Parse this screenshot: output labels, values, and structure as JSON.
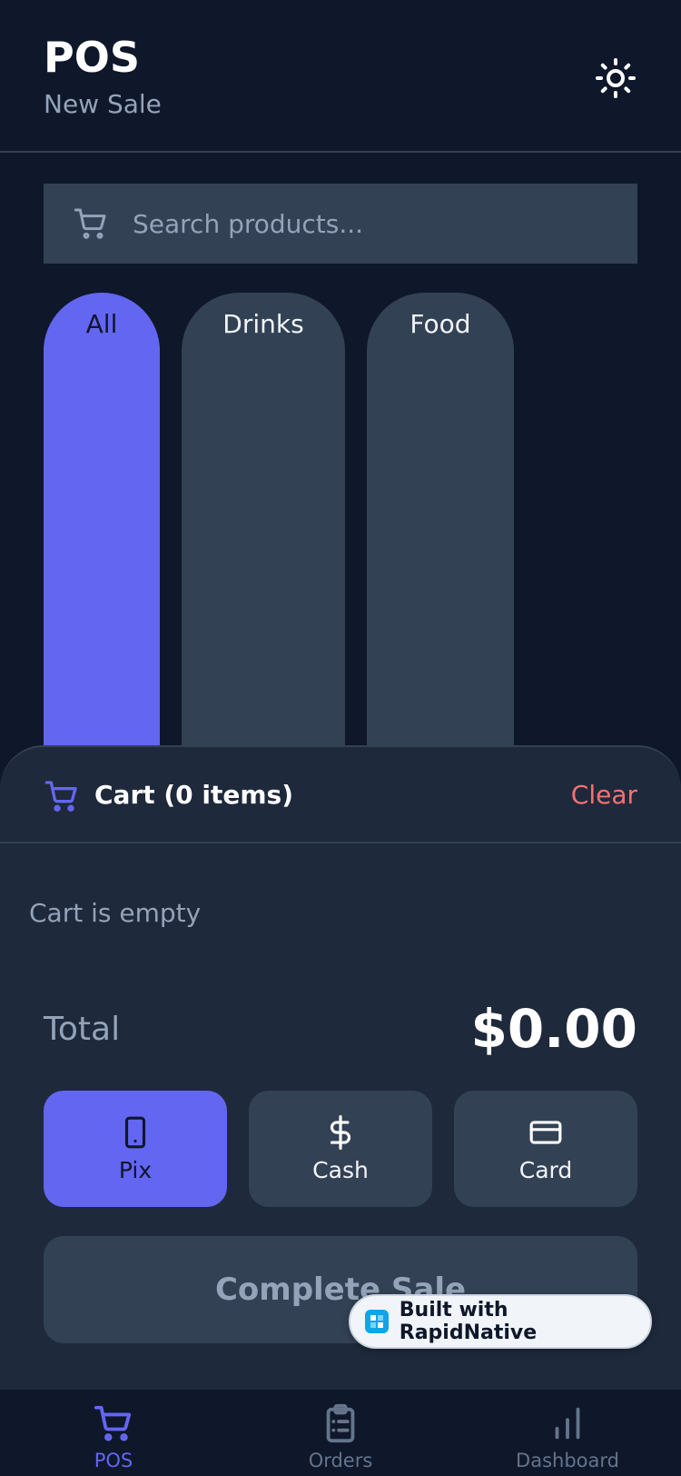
{
  "header": {
    "title": "POS",
    "subtitle": "New Sale",
    "theme_icon": "sun-icon"
  },
  "search": {
    "placeholder": "Search products...",
    "value": ""
  },
  "categories": [
    {
      "label": "All",
      "active": true
    },
    {
      "label": "Drinks",
      "active": false
    },
    {
      "label": "Food",
      "active": false
    }
  ],
  "cart": {
    "title": "Cart (0 items)",
    "clear_label": "Clear",
    "empty_text": "Cart is empty",
    "total_label": "Total",
    "total_value": "$0.00"
  },
  "payment_methods": [
    {
      "label": "Pix",
      "icon": "smartphone-icon",
      "active": true
    },
    {
      "label": "Cash",
      "icon": "dollar-icon",
      "active": false
    },
    {
      "label": "Card",
      "icon": "credit-card-icon",
      "active": false
    }
  ],
  "complete_sale_label": "Complete Sale",
  "badge": {
    "text": "Built with RapidNative"
  },
  "tabs": [
    {
      "label": "POS",
      "icon": "cart-icon",
      "active": true
    },
    {
      "label": "Orders",
      "icon": "clipboard-icon",
      "active": false
    },
    {
      "label": "Dashboard",
      "icon": "bar-chart-icon",
      "active": false
    }
  ],
  "colors": {
    "background": "#0f172a",
    "surface": "#1e293b",
    "muted_surface": "#334155",
    "accent": "#6366f1",
    "danger": "#f87171",
    "muted_text": "#94a3b8"
  }
}
